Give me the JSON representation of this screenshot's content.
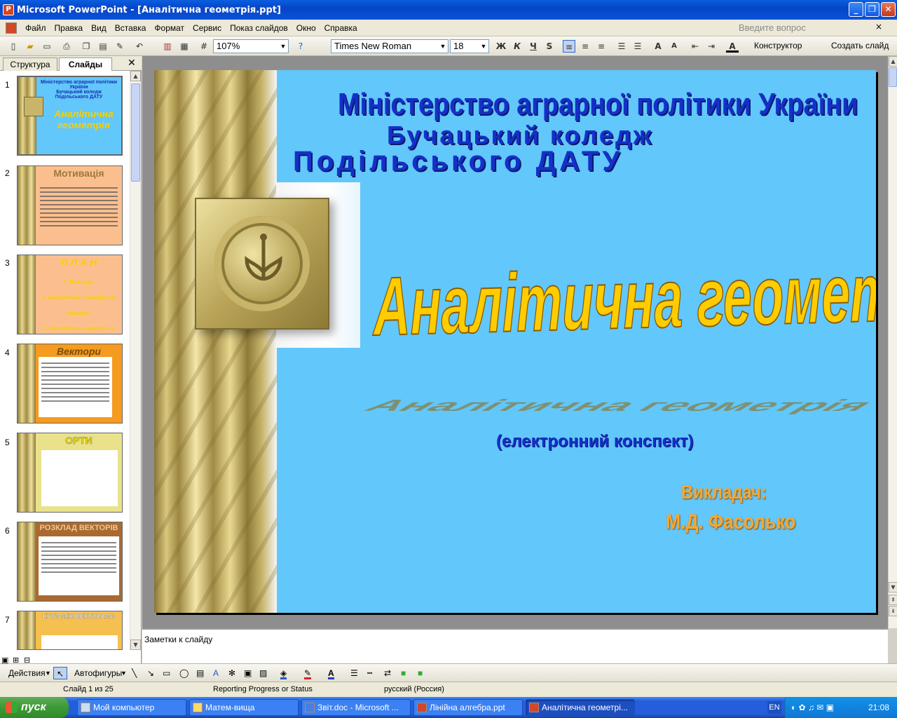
{
  "window": {
    "title": "Microsoft PowerPoint - [Аналітична геометрія.ppt]"
  },
  "menu": {
    "items": [
      "Файл",
      "Правка",
      "Вид",
      "Вставка",
      "Формат",
      "Сервис",
      "Показ слайдов",
      "Окно",
      "Справка"
    ],
    "ask_placeholder": "Введите вопрос"
  },
  "toolbar": {
    "zoom": "107%",
    "font": "Times New Roman",
    "size": "18",
    "bold": "Ж",
    "italic": "К",
    "underline": "Ч",
    "shadow": "S",
    "designer": "Конструктор",
    "new_slide": "Создать слайд"
  },
  "tabs": {
    "outline": "Структура",
    "slides": "Слайды"
  },
  "thumbnails": [
    {
      "num": "1",
      "title": "Аналітична геометрія",
      "bg": "#62c7fb"
    },
    {
      "num": "2",
      "title": "Мотивація",
      "bg": "#fbbf8f"
    },
    {
      "num": "3",
      "title": "П Л А Н",
      "bg": "#fbbf8f",
      "lines": [
        "1. Вектори.",
        "2. Аналітична геометрія на площині.",
        "3. Аналітична геометрія в просторі"
      ]
    },
    {
      "num": "4",
      "title": "Вектори",
      "bg": "#f59b1f"
    },
    {
      "num": "5",
      "title": "ОРТИ",
      "bg": "#e9e28a"
    },
    {
      "num": "6",
      "title": "РОЗКЛАД ВЕКТОРІВ",
      "bg": "#a86a32"
    },
    {
      "num": "7",
      "title": "КУТИ МІЖ ВЕКТОРАМИ",
      "bg": "#f5c04f"
    }
  ],
  "slide": {
    "line1": "Міністерство аграрної політики України",
    "line2": "Бучацький коледж",
    "line3": "Подільського ДАТУ",
    "title": "Аналітична геометрія",
    "subtitle": "(електронний конспект)",
    "teacher_label": "Викладач:",
    "teacher_name": "М.Д. Фасолько"
  },
  "notes": {
    "placeholder": "Заметки к слайду"
  },
  "drawbar": {
    "actions": "Действия",
    "autoshapes": "Автофигуры"
  },
  "status": {
    "slide": "Слайд 1 из 25",
    "progress": "Reporting Progress or Status",
    "lang": "русский (Россия)"
  },
  "taskbar": {
    "start": "пуск",
    "tasks": [
      "Мой компьютер",
      "Матем-вища",
      "Звіт.doc - Microsoft ...",
      "Лінійна алгебра.ppt",
      "Аналітична геометрі..."
    ],
    "lang": "EN",
    "clock": "21:08"
  }
}
